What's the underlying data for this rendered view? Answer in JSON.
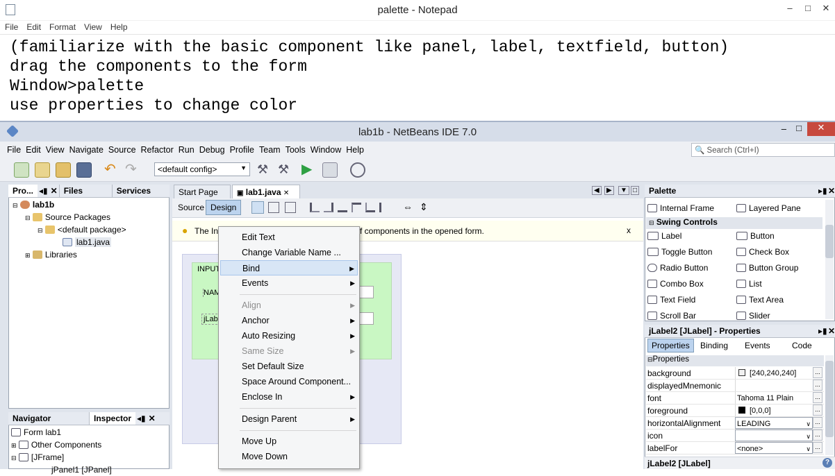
{
  "notepad": {
    "title": "palette - Notepad",
    "menu": [
      "File",
      "Edit",
      "Format",
      "View",
      "Help"
    ],
    "lines": [
      "(familiarize with the basic component like panel, label, textfield, button)",
      "drag the components to the form",
      "Window>palette",
      "use properties to change color"
    ]
  },
  "netbeans": {
    "title": "lab1b - NetBeans IDE 7.0",
    "menu": [
      "File",
      "Edit",
      "View",
      "Navigate",
      "Source",
      "Refactor",
      "Run",
      "Debug",
      "Profile",
      "Team",
      "Tools",
      "Window",
      "Help"
    ],
    "search_placeholder": "Search (Ctrl+I)",
    "config": "<default config>",
    "projects_tabs": [
      "Pro...",
      "Files",
      "Services"
    ],
    "tree": {
      "root": "lab1b",
      "source_packages": "Source Packages",
      "default_package": "<default package>",
      "file": "lab1.java",
      "libraries": "Libraries"
    },
    "navigator_tabs": [
      "Navigator",
      "Inspector"
    ],
    "inspector": {
      "form": "Form lab1",
      "other": "Other Components",
      "jframe": "[JFrame]",
      "jpanel": "jPanel1 [JPanel]"
    },
    "editor_tabs": [
      "Start Page",
      "lab1.java"
    ],
    "editor_modes": [
      "Source",
      "Design"
    ],
    "info_text": "The In",
    "info_text_right": "f components in the opened form.",
    "form_labels": {
      "input": "INPUT",
      "name": "NAM",
      "jlabel": "jLabe"
    }
  },
  "context_menu": [
    {
      "label": "Edit Text",
      "enabled": true,
      "sub": false
    },
    {
      "label": "Change Variable Name ...",
      "enabled": true,
      "sub": false
    },
    {
      "label": "Bind",
      "enabled": true,
      "sub": true,
      "highlighted": true
    },
    {
      "label": "Events",
      "enabled": true,
      "sub": true
    },
    {
      "label": "Align",
      "enabled": false,
      "sub": true
    },
    {
      "label": "Anchor",
      "enabled": true,
      "sub": true
    },
    {
      "label": "Auto Resizing",
      "enabled": true,
      "sub": true
    },
    {
      "label": "Same Size",
      "enabled": false,
      "sub": true
    },
    {
      "label": "Set Default Size",
      "enabled": true,
      "sub": false
    },
    {
      "label": "Space Around Component...",
      "enabled": true,
      "sub": false
    },
    {
      "label": "Enclose In",
      "enabled": true,
      "sub": true
    },
    {
      "label": "Design Parent",
      "enabled": true,
      "sub": true
    },
    {
      "label": "Move Up",
      "enabled": true,
      "sub": false
    },
    {
      "label": "Move Down",
      "enabled": true,
      "sub": false
    }
  ],
  "palette": {
    "title": "Palette",
    "top_items": [
      "Internal Frame",
      "Layered Pane"
    ],
    "section": "Swing Controls",
    "items": [
      [
        "Label",
        "Button"
      ],
      [
        "Toggle Button",
        "Check Box"
      ],
      [
        "Radio Button",
        "Button Group"
      ],
      [
        "Combo Box",
        "List"
      ],
      [
        "Text Field",
        "Text Area"
      ],
      [
        "Scroll Bar",
        "Slider"
      ]
    ]
  },
  "properties": {
    "title": "jLabel2 [JLabel] - Properties",
    "tabs": [
      "Properties",
      "Binding",
      "Events",
      "Code"
    ],
    "section": "Properties",
    "rows": [
      {
        "name": "background",
        "value": "[240,240,240]",
        "swatch": "#f0f0f0"
      },
      {
        "name": "displayedMnemonic",
        "value": ""
      },
      {
        "name": "font",
        "value": "Tahoma 11 Plain"
      },
      {
        "name": "foreground",
        "value": "[0,0,0]",
        "swatch": "#000000"
      },
      {
        "name": "horizontalAlignment",
        "value": "LEADING",
        "combo": true
      },
      {
        "name": "icon",
        "value": "",
        "combo": true
      },
      {
        "name": "labelFor",
        "value": "<none>",
        "combo": true
      }
    ],
    "footer": "jLabel2 [JLabel]"
  }
}
